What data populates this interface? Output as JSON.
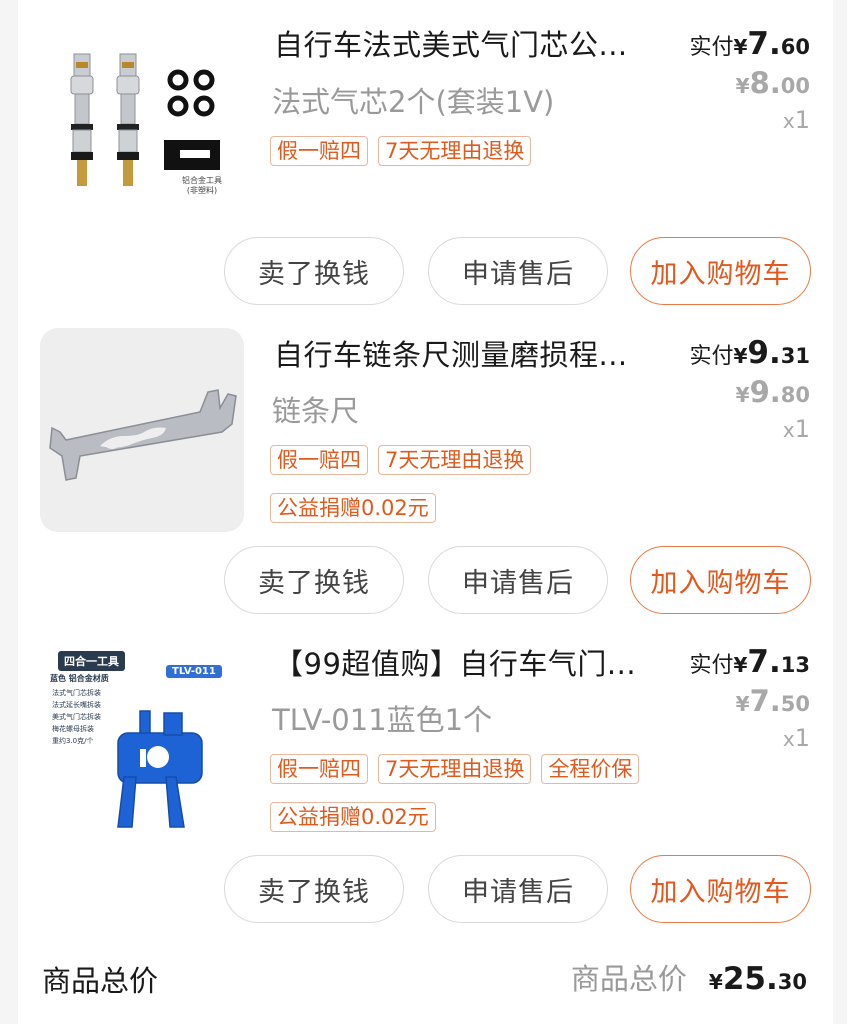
{
  "items": [
    {
      "title": "自行车法式美式气门芯公...",
      "spec": "法式气芯2个(套装1V)",
      "tags": [
        "假一赔四",
        "7天无理由退换"
      ],
      "paid_label": "实付",
      "paid_currency": "¥",
      "paid_int": "7.",
      "paid_dec": "60",
      "orig_currency": "¥",
      "orig_int": "8.",
      "orig_dec": "00",
      "qty_prefix": "x",
      "qty": "1",
      "image_caption": "铝合金工具",
      "image_caption2": "(非塑料)"
    },
    {
      "title": "自行车链条尺测量磨损程...",
      "spec": "链条尺",
      "tags": [
        "假一赔四",
        "7天无理由退换"
      ],
      "tags2": [
        "公益捐赠0.02元"
      ],
      "paid_label": "实付",
      "paid_currency": "¥",
      "paid_int": "9.",
      "paid_dec": "31",
      "orig_currency": "¥",
      "orig_int": "9.",
      "orig_dec": "80",
      "qty_prefix": "x",
      "qty": "1"
    },
    {
      "title": "【99超值购】自行车气门...",
      "spec": "TLV-011蓝色1个",
      "tags": [
        "假一赔四",
        "7天无理由退换",
        "全程价保"
      ],
      "tags2": [
        "公益捐赠0.02元"
      ],
      "paid_label": "实付",
      "paid_currency": "¥",
      "paid_int": "7.",
      "paid_dec": "13",
      "orig_currency": "¥",
      "orig_int": "7.",
      "orig_dec": "50",
      "qty_prefix": "x",
      "qty": "1",
      "image_header": "四合一工具",
      "image_model": "TLV-011",
      "image_subheader": "蓝色 铝合金材质",
      "image_features": [
        "法式气门芯拆装",
        "法式延长嘴拆装",
        "美式气门芯拆装",
        "梅花螺母拆装",
        "重约3.0克/个"
      ]
    }
  ],
  "buttons": {
    "sell": "卖了换钱",
    "after_sale": "申请售后",
    "add_cart": "加入购物车"
  },
  "total": {
    "left_label": "商品总价",
    "right_label": "商品总价",
    "currency": "¥",
    "int": "25.",
    "dec": "30"
  },
  "colors": {
    "accent": "#e4571d",
    "tag_border": "#e8b89c",
    "muted": "#9a9a9a"
  }
}
